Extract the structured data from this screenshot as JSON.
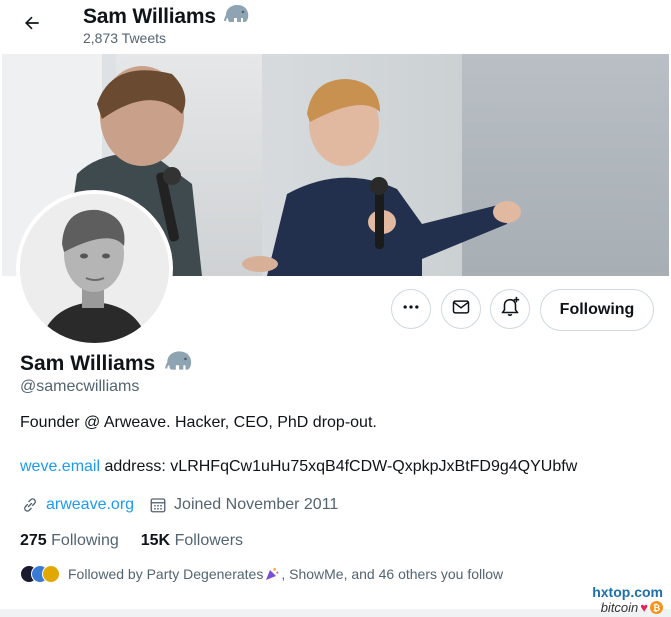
{
  "header": {
    "name": "Sam Williams",
    "tweet_count": "2,873 Tweets"
  },
  "actions": {
    "following_label": "Following"
  },
  "profile": {
    "name": "Sam Williams",
    "handle": "@samecwilliams",
    "bio": "Founder @ Arweave. Hacker, CEO, PhD drop-out.",
    "address_link": "weve.email",
    "address_text": " address: vLRHFqCw1uHu75xqB4fCDW-QxpkpJxBtFD9g4QYUbfw",
    "website": "arweave.org",
    "joined": "Joined November 2011"
  },
  "stats": {
    "following_count": "275",
    "following_label": "Following",
    "followers_count": "15K",
    "followers_label": "Followers"
  },
  "followed_by": {
    "prefix": "Followed by Party Degenerates ",
    "suffix": ", ShowMe, and 46 others you follow"
  },
  "watermark": {
    "site": "hxtop.com",
    "tag": "bitcoin"
  },
  "icons": {
    "back": "arrow-left-icon",
    "badge": "elephant-icon",
    "more": "more-icon",
    "message": "envelope-icon",
    "notify": "bell-plus-icon",
    "link": "link-icon",
    "calendar": "calendar-icon"
  },
  "colors": {
    "link": "#1d9bf0",
    "secondary_text": "#536471",
    "primary_text": "#0f1419",
    "border": "#cfd9de"
  }
}
